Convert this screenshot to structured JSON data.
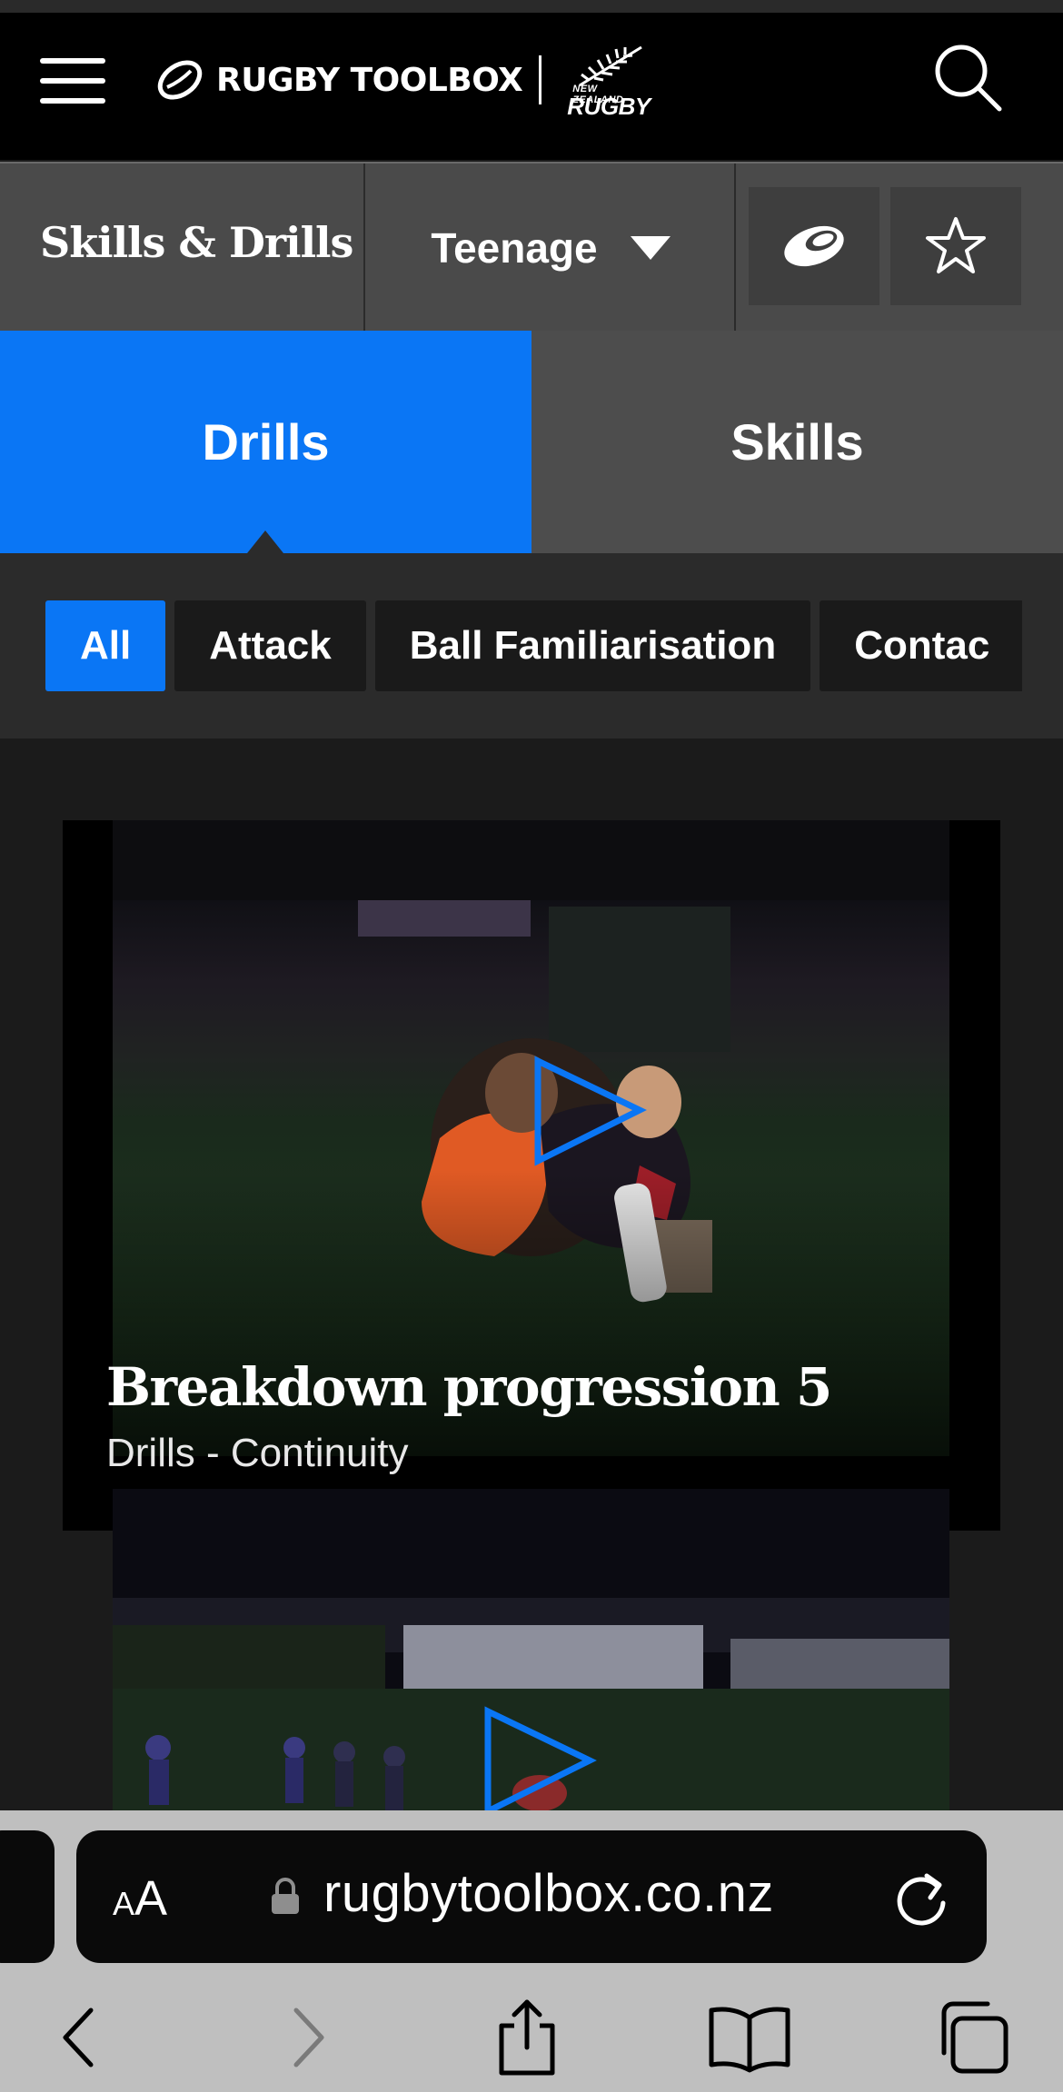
{
  "header": {
    "brand": "RUGBY TOOLBOX",
    "partner_small": "NEW ZEALAND",
    "partner_big": "RUGBY"
  },
  "subnav": {
    "section_title": "Skills & Drills",
    "age_group": "Teenage"
  },
  "tabs": [
    {
      "label": "Drills",
      "active": true
    },
    {
      "label": "Skills",
      "active": false
    }
  ],
  "filters": [
    {
      "label": "All",
      "active": true
    },
    {
      "label": "Attack",
      "active": false
    },
    {
      "label": "Ball Familiarisation",
      "active": false
    },
    {
      "label": "Contac",
      "active": false
    }
  ],
  "cards": [
    {
      "title": "Breakdown progression 5",
      "subtitle": "Drills - Continuity"
    }
  ],
  "browser": {
    "text_size_label_small": "A",
    "text_size_label_big": "A",
    "url": "rugbytoolbox.co.nz"
  },
  "colors": {
    "accent": "#0a76f5",
    "header_bg": "#000000",
    "subnav_bg": "#4a4a4a",
    "content_bg": "#1b1b1b"
  },
  "icons": [
    "menu-icon",
    "rugby-ball-icon",
    "silver-fern-icon",
    "search-icon",
    "caret-down-icon",
    "rugby-ball-icon",
    "star-icon",
    "play-icon",
    "lock-icon",
    "reload-icon",
    "back-icon",
    "forward-icon",
    "share-icon",
    "bookmarks-icon",
    "tabs-icon"
  ]
}
